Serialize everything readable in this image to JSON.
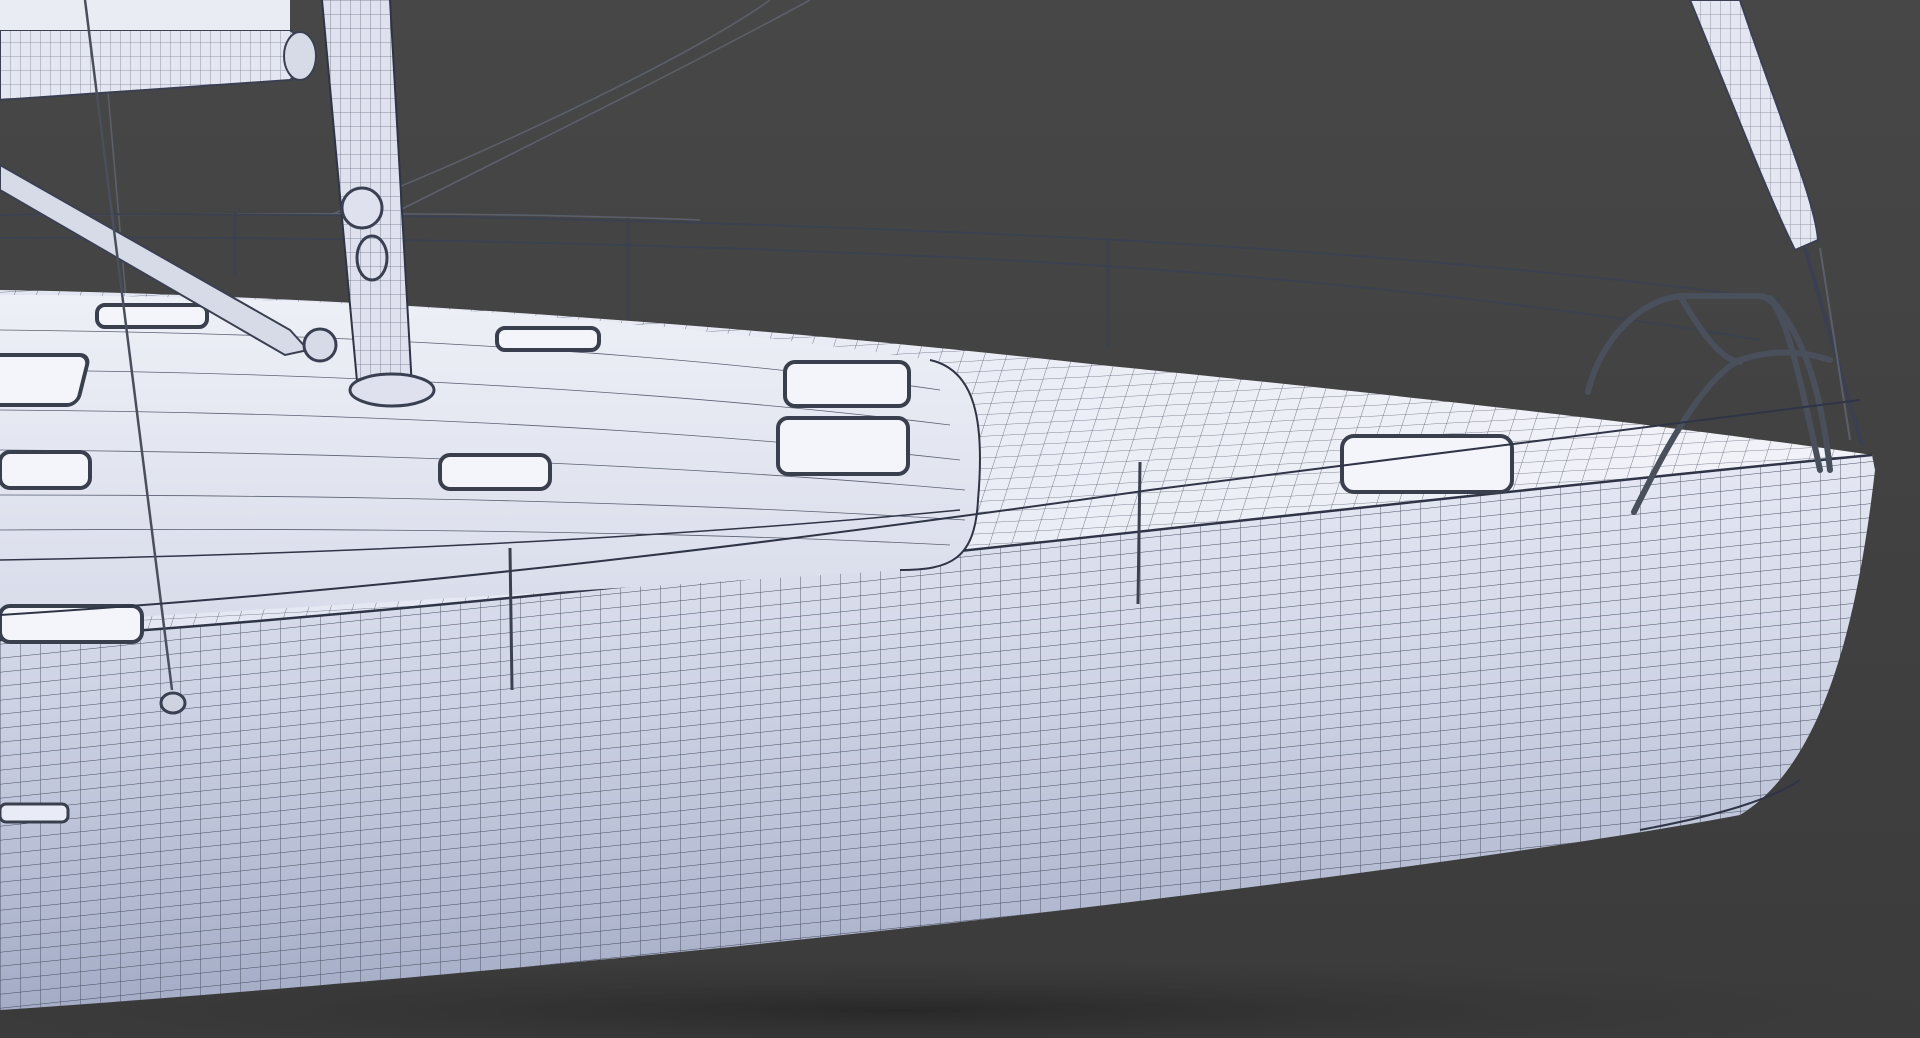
{
  "scene": {
    "subject": "sailboat-wireframe-render",
    "colors": {
      "background_top": "#474747",
      "background_bottom": "#3c3c3c",
      "hull_light": "#e9ecf6",
      "hull_mid": "#c6ccde",
      "hull_shadow": "#9aa2bb",
      "deck_light": "#eef0f7",
      "wire": "#2f3446",
      "rigging": "#555a66",
      "hatch_glass": "#f4f5fa",
      "ground_shadow": "#2a2a2a"
    },
    "elements": [
      "hull",
      "deck",
      "cabin-top",
      "mast",
      "boom",
      "furled-jib",
      "bow-pulpit",
      "lifelines",
      "stanchions",
      "deck-hatches",
      "portlights",
      "forestay",
      "shrouds"
    ]
  }
}
